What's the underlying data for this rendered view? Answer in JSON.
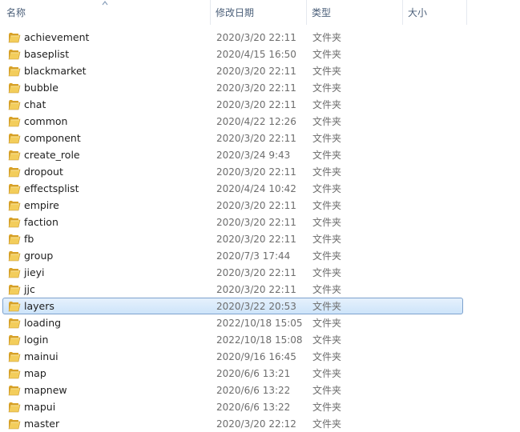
{
  "columns": {
    "name": "名称",
    "date": "修改日期",
    "type": "类型",
    "size": "大小"
  },
  "sort_icon": "sort-ascending-caret-icon",
  "folder_icon": "folder-icon",
  "colors": {
    "selection_fill": "#cde4fa",
    "selection_border": "#7da2ce",
    "header_text": "#4c607a",
    "secondary_text": "#6d6d6d",
    "folder": "#e8b93a"
  },
  "rows": [
    {
      "name": "achievement",
      "date": "2020/3/20 22:11",
      "type": "文件夹"
    },
    {
      "name": "baseplist",
      "date": "2020/4/15 16:50",
      "type": "文件夹"
    },
    {
      "name": "blackmarket",
      "date": "2020/3/20 22:11",
      "type": "文件夹"
    },
    {
      "name": "bubble",
      "date": "2020/3/20 22:11",
      "type": "文件夹"
    },
    {
      "name": "chat",
      "date": "2020/3/20 22:11",
      "type": "文件夹"
    },
    {
      "name": "common",
      "date": "2020/4/22 12:26",
      "type": "文件夹"
    },
    {
      "name": "component",
      "date": "2020/3/20 22:11",
      "type": "文件夹"
    },
    {
      "name": "create_role",
      "date": "2020/3/24 9:43",
      "type": "文件夹"
    },
    {
      "name": "dropout",
      "date": "2020/3/20 22:11",
      "type": "文件夹"
    },
    {
      "name": "effectsplist",
      "date": "2020/4/24 10:42",
      "type": "文件夹"
    },
    {
      "name": "empire",
      "date": "2020/3/20 22:11",
      "type": "文件夹"
    },
    {
      "name": "faction",
      "date": "2020/3/20 22:11",
      "type": "文件夹"
    },
    {
      "name": "fb",
      "date": "2020/3/20 22:11",
      "type": "文件夹"
    },
    {
      "name": "group",
      "date": "2020/7/3 17:44",
      "type": "文件夹"
    },
    {
      "name": "jieyi",
      "date": "2020/3/20 22:11",
      "type": "文件夹"
    },
    {
      "name": "jjc",
      "date": "2020/3/20 22:11",
      "type": "文件夹"
    },
    {
      "name": "layers",
      "date": "2020/3/22 20:53",
      "type": "文件夹",
      "selected": true
    },
    {
      "name": "loading",
      "date": "2022/10/18 15:05",
      "type": "文件夹"
    },
    {
      "name": "login",
      "date": "2022/10/18 15:08",
      "type": "文件夹"
    },
    {
      "name": "mainui",
      "date": "2020/9/16 16:45",
      "type": "文件夹"
    },
    {
      "name": "map",
      "date": "2020/6/6 13:21",
      "type": "文件夹"
    },
    {
      "name": "mapnew",
      "date": "2020/6/6 13:22",
      "type": "文件夹"
    },
    {
      "name": "mapui",
      "date": "2020/6/6 13:22",
      "type": "文件夹"
    },
    {
      "name": "master",
      "date": "2020/3/20 22:12",
      "type": "文件夹"
    }
  ]
}
